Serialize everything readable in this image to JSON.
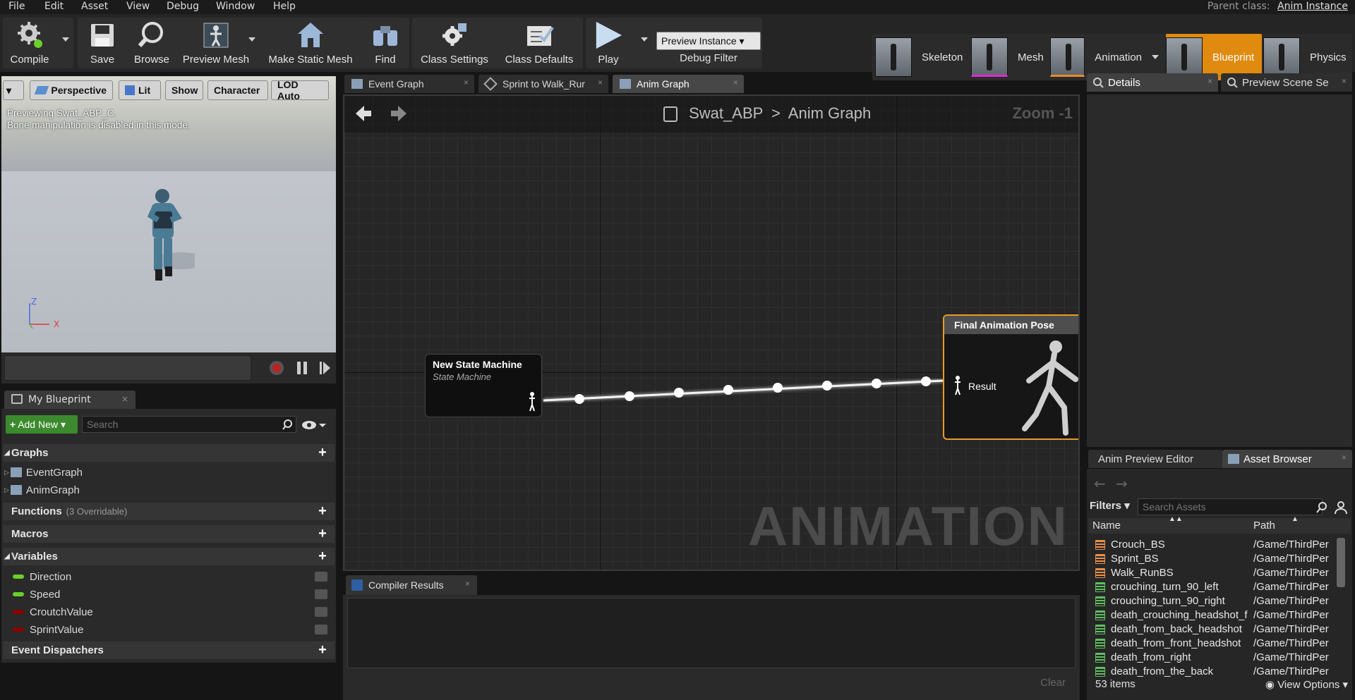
{
  "menu": [
    "File",
    "Edit",
    "Asset",
    "View",
    "Debug",
    "Window",
    "Help"
  ],
  "parent_class": {
    "label": "Parent class:",
    "value": "Anim Instance"
  },
  "toolbar": {
    "compile": "Compile",
    "save": "Save",
    "browse": "Browse",
    "preview_mesh": "Preview Mesh",
    "make_static_mesh": "Make Static Mesh",
    "find": "Find",
    "class_settings": "Class Settings",
    "class_defaults": "Class Defaults",
    "play": "Play",
    "preview_instance": "Preview Instance",
    "debug_filter": "Debug Filter"
  },
  "modes": [
    "Skeleton",
    "Mesh",
    "Animation",
    "Blueprint",
    "Physics"
  ],
  "active_mode": "Blueprint",
  "viewport": {
    "buttons": [
      "Perspective",
      "Lit",
      "Show",
      "Character",
      "LOD Auto"
    ],
    "info_line1": "Previewing Swat_ABP_C.",
    "info_line2": "Bone manipulation is disabled in this mode.",
    "axis_z": "Z",
    "axis_x": "X"
  },
  "my_blueprint": {
    "tab": "My Blueprint",
    "add_new": "Add New",
    "search_placeholder": "Search",
    "graphs_label": "Graphs",
    "graphs": [
      "EventGraph",
      "AnimGraph"
    ],
    "functions_label": "Functions",
    "functions_sub": "(3 Overridable)",
    "macros_label": "Macros",
    "variables_label": "Variables",
    "variables": [
      {
        "name": "Direction",
        "color": "#6ad02a"
      },
      {
        "name": "Speed",
        "color": "#6ad02a"
      },
      {
        "name": "CroutchValue",
        "color": "#8a0000"
      },
      {
        "name": "SprintValue",
        "color": "#8a0000"
      }
    ],
    "dispatchers_label": "Event Dispatchers"
  },
  "graph": {
    "tabs": [
      "Event Graph",
      "Sprint to Walk_Rur",
      "Anim Graph"
    ],
    "active_tab": "Anim Graph",
    "crumb_root": "Swat_ABP",
    "crumb_sep": ">",
    "crumb_leaf": "Anim Graph",
    "zoom": "Zoom -1",
    "watermark": "ANIMATION",
    "state_machine_title": "New State Machine",
    "state_machine_sub": "State Machine",
    "final_pose_title": "Final Animation Pose",
    "result_label": "Result"
  },
  "compiler": {
    "tab": "Compiler Results",
    "clear": "Clear"
  },
  "right": {
    "details_tab": "Details",
    "preview_tab": "Preview Scene Se",
    "anim_preview_tab": "Anim Preview Editor",
    "asset_browser_tab": "Asset Browser",
    "filters": "Filters",
    "search_placeholder": "Search Assets",
    "col_name": "Name",
    "col_path": "Path",
    "assets": [
      {
        "name": "Crouch_BS",
        "path": "/Game/ThirdPer",
        "kind": "blendspace"
      },
      {
        "name": "Sprint_BS",
        "path": "/Game/ThirdPer",
        "kind": "blendspace"
      },
      {
        "name": "Walk_RunBS",
        "path": "/Game/ThirdPer",
        "kind": "blendspace"
      },
      {
        "name": "crouching_turn_90_left",
        "path": "/Game/ThirdPer",
        "kind": "sequence"
      },
      {
        "name": "crouching_turn_90_right",
        "path": "/Game/ThirdPer",
        "kind": "sequence"
      },
      {
        "name": "death_crouching_headshot_f",
        "path": "/Game/ThirdPer",
        "kind": "sequence"
      },
      {
        "name": "death_from_back_headshot",
        "path": "/Game/ThirdPer",
        "kind": "sequence"
      },
      {
        "name": "death_from_front_headshot",
        "path": "/Game/ThirdPer",
        "kind": "sequence"
      },
      {
        "name": "death_from_right",
        "path": "/Game/ThirdPer",
        "kind": "sequence"
      },
      {
        "name": "death_from_the_back",
        "path": "/Game/ThirdPer",
        "kind": "sequence"
      }
    ],
    "item_count": "53 items",
    "view_options": "View Options"
  }
}
